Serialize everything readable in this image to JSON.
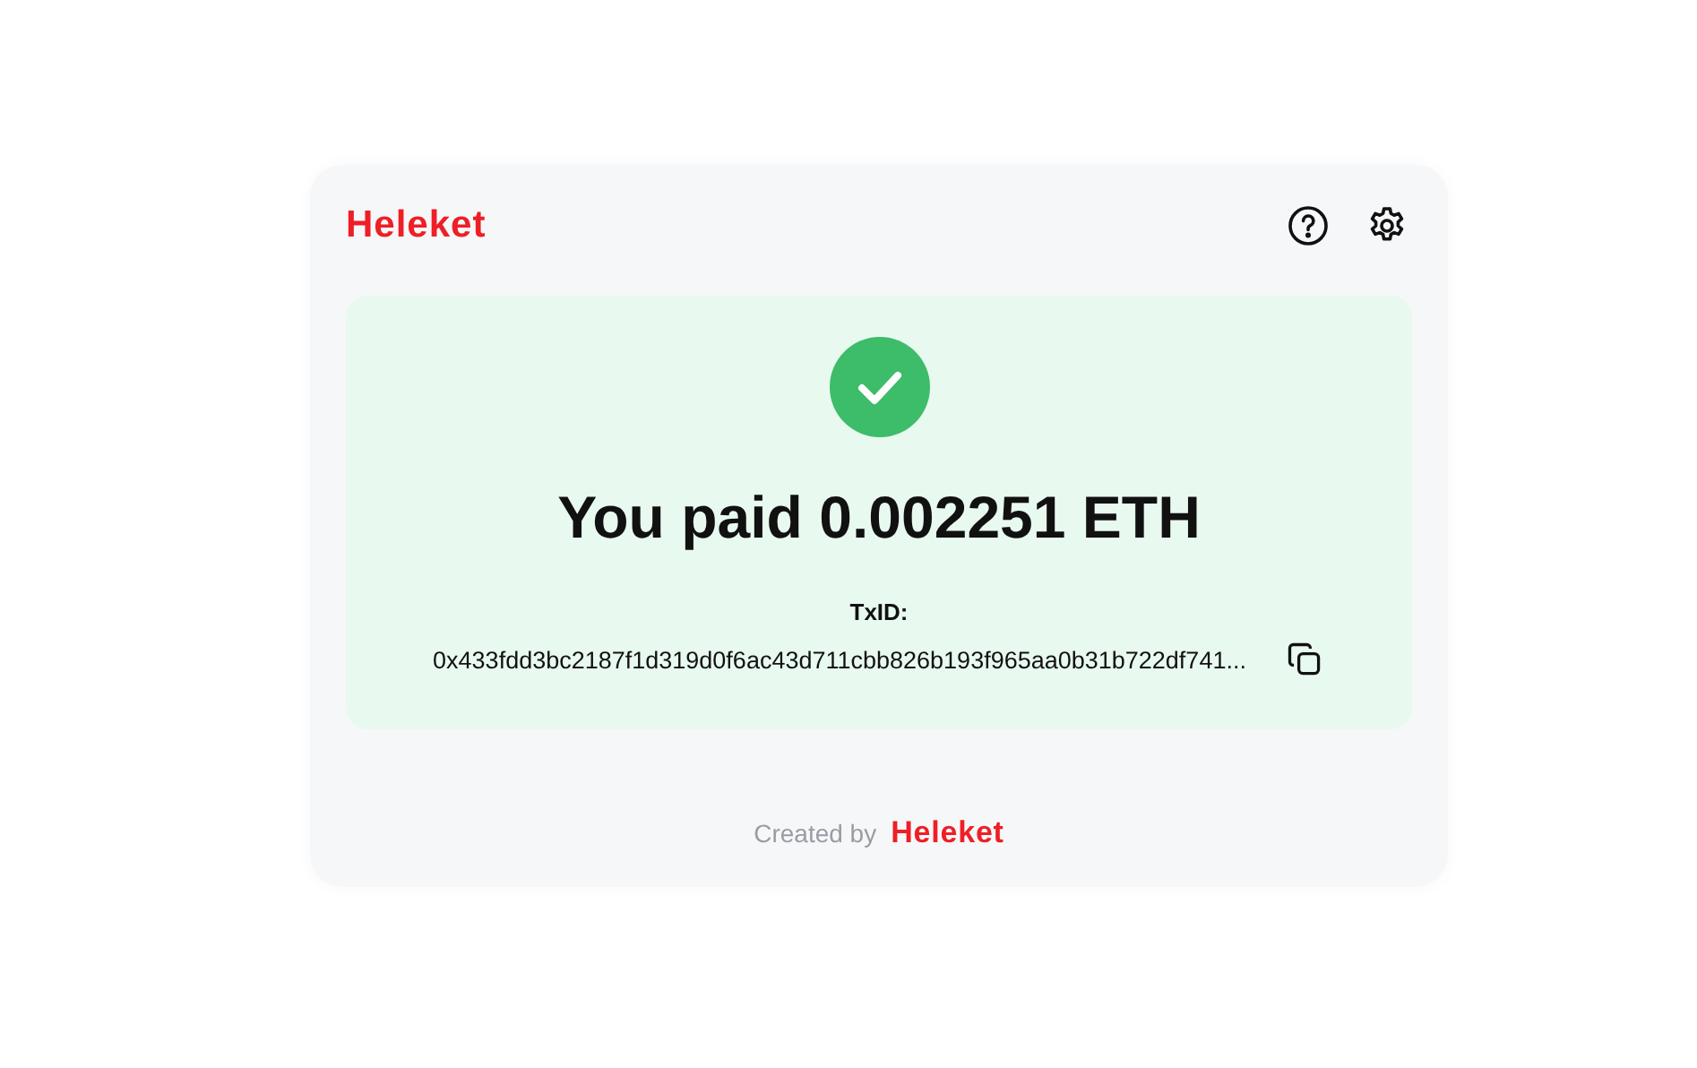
{
  "header": {
    "logo": "Heleket"
  },
  "status": {
    "kind": "success",
    "title": "You paid 0.002251 ETH",
    "txid_label": "TxID:",
    "txid": "0x433fdd3bc2187f1d319d0f6ac43d711cbb826b193f965aa0b31b722df741..."
  },
  "footer": {
    "created_by": "Created by",
    "logo": "Heleket"
  }
}
